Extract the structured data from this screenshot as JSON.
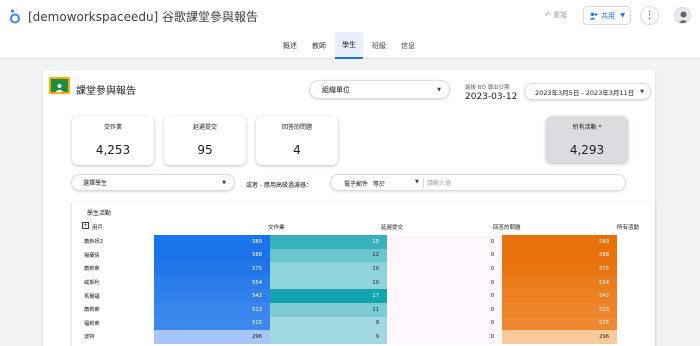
{
  "app": {
    "title": "[demoworkspaceedu] 谷歌課堂參與報告",
    "undo_label": "重設",
    "share_label": "共用",
    "more_label": "⋮"
  },
  "tabs": [
    {
      "label": "概述",
      "active": false
    },
    {
      "label": "教師",
      "active": false
    },
    {
      "label": "學生",
      "active": true
    },
    {
      "label": "班級",
      "active": false
    },
    {
      "label": "信息",
      "active": false
    }
  ],
  "report": {
    "title": "課堂參與報告",
    "org_unit_label": "組織單位",
    "extract_label": "最後 BQ 導出日期",
    "extract_date": "2023-03-12",
    "date_range": "2023年3月5日 - 2023年3月11日"
  },
  "scorecards": [
    {
      "label": "交作業",
      "value": "4,253"
    },
    {
      "label": "延遲提交",
      "value": "95"
    },
    {
      "label": "回答的問題",
      "value": "4"
    },
    {
      "label": "所有活動 *",
      "value": "4,293"
    }
  ],
  "filters": {
    "student_select_label": "選擇學生",
    "or_label": "或者 - 應用高級過濾器：",
    "field_label": "電子郵件",
    "operator_label": "等於",
    "input_placeholder": "請輸入值"
  },
  "table": {
    "title": "學生活動",
    "headers": {
      "user": "用戶",
      "submitted": "交作業",
      "late": "延遲提交",
      "questions": "回答的問題",
      "total": "所有活動"
    },
    "max": {
      "submitted": 589,
      "late": 17,
      "questions": 1,
      "total": 589
    },
    "rows": [
      {
        "name": "蕭新妍2",
        "submitted": "589",
        "late": "15",
        "questions": "0",
        "total": "589"
      },
      {
        "name": "楊蘭倩",
        "submitted": "588",
        "late": "12",
        "questions": "0",
        "total": "588"
      },
      {
        "name": "蕭新萊",
        "submitted": "575",
        "late": "10",
        "questions": "0",
        "total": "575"
      },
      {
        "name": "威斯利",
        "submitted": "554",
        "late": "10",
        "questions": "0",
        "total": "554"
      },
      {
        "name": "馬爾福",
        "submitted": "542",
        "late": "17",
        "questions": "0",
        "total": "542"
      },
      {
        "name": "蕭新萊",
        "submitted": "523",
        "late": "11",
        "questions": "0",
        "total": "523"
      },
      {
        "name": "福新萊",
        "submitted": "515",
        "late": "9",
        "questions": "0",
        "total": "515"
      },
      {
        "name": "波特",
        "submitted": "296",
        "late": "9",
        "questions": "0",
        "total": "296"
      }
    ]
  },
  "colors": {
    "accent": "#1a73e8",
    "submitted_dark": "#1a73e8",
    "submitted_light": "#aecbfa",
    "late_dark": "#12a4af",
    "late_light": "#b3e0e8",
    "total_dark": "#e8710a",
    "total_light": "#fbcfa5",
    "questions_bg": "#fdf6fc"
  }
}
